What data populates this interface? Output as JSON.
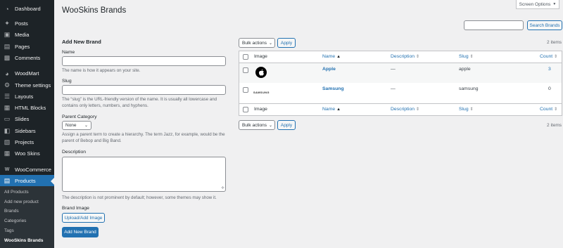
{
  "sidebar": {
    "items": [
      {
        "label": "Dashboard",
        "icon": "dashboard-icon"
      },
      {
        "label": "Posts",
        "icon": "pin-icon"
      },
      {
        "label": "Media",
        "icon": "media-icon"
      },
      {
        "label": "Pages",
        "icon": "page-icon"
      },
      {
        "label": "Comments",
        "icon": "comment-icon"
      },
      {
        "label": "WoodMart",
        "icon": "woodmart-icon"
      },
      {
        "label": "Theme settings",
        "icon": "gear-icon"
      },
      {
        "label": "Layouts",
        "icon": "layers-icon"
      },
      {
        "label": "HTML Blocks",
        "icon": "blocks-icon"
      },
      {
        "label": "Slides",
        "icon": "slides-icon"
      },
      {
        "label": "Sidebars",
        "icon": "sidebar-icon"
      },
      {
        "label": "Projects",
        "icon": "projects-icon"
      },
      {
        "label": "Woo Skins",
        "icon": "skins-icon"
      },
      {
        "label": "WooCommerce",
        "icon": "woocommerce-icon"
      },
      {
        "label": "Products",
        "icon": "products-icon"
      }
    ],
    "submenu": [
      "All Products",
      "Add new product",
      "Brands",
      "Categories",
      "Tags",
      "WooSkins Brands"
    ]
  },
  "header": {
    "title": "WooSkins Brands",
    "screen_options": "Screen Options",
    "search_button": "Search Brands",
    "search_value": ""
  },
  "form": {
    "heading": "Add New Brand",
    "name_label": "Name",
    "name_hint": "The name is how it appears on your site.",
    "slug_label": "Slug",
    "slug_hint": "The “slug” is the URL-friendly version of the name. It is usually all lowercase and contains only letters, numbers, and hyphens.",
    "parent_label": "Parent Category",
    "parent_value": "None",
    "parent_hint": "Assign a parent term to create a hierarchy. The term Jazz, for example, would be the parent of Bebop and Big Band.",
    "description_label": "Description",
    "description_hint": "The description is not prominent by default; however, some themes may show it.",
    "brand_image_label": "Brand Image",
    "upload_button": "Upload/Add Image",
    "submit_button": "Add New Brand"
  },
  "table": {
    "bulk_actions": "Bulk actions",
    "apply": "Apply",
    "items_count": "2 items",
    "columns": {
      "image": "Image",
      "name": "Name",
      "description": "Description",
      "slug": "Slug",
      "count": "Count"
    },
    "rows": [
      {
        "name": "Apple",
        "description": "—",
        "slug": "apple",
        "count": "3",
        "logo": "apple-logo"
      },
      {
        "name": "Samsung",
        "description": "—",
        "slug": "samsung",
        "count": "0",
        "logo": "samsung-logo",
        "logo_text": "SAMSUNG"
      }
    ]
  },
  "colors": {
    "accent": "#2271b1",
    "sidebar_bg": "#1d2327",
    "submenu_bg": "#2c3338"
  }
}
